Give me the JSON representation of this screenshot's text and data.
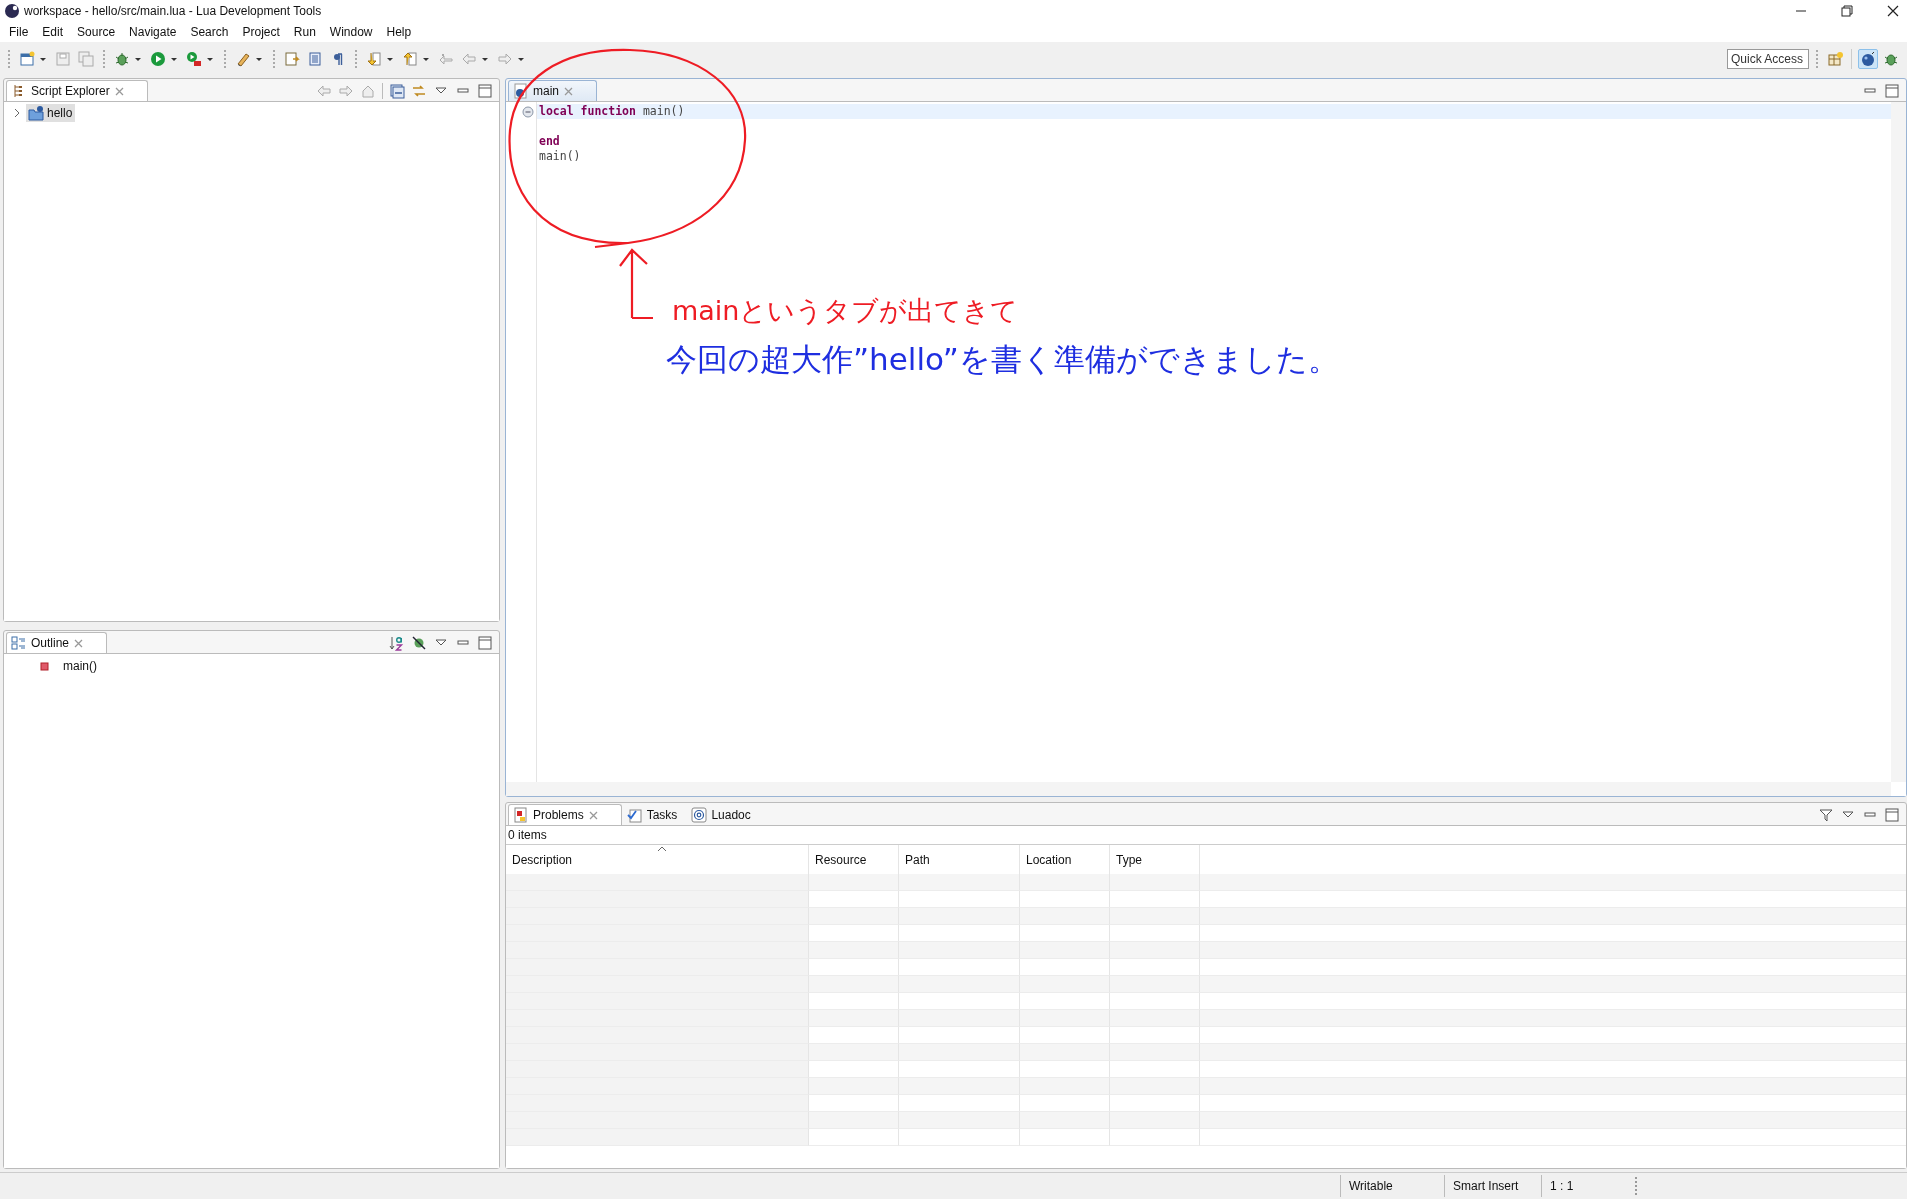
{
  "window": {
    "title": "workspace - hello/src/main.lua - Lua Development Tools"
  },
  "menu": [
    {
      "label": "File"
    },
    {
      "label": "Edit"
    },
    {
      "label": "Source"
    },
    {
      "label": "Navigate"
    },
    {
      "label": "Search"
    },
    {
      "label": "Project"
    },
    {
      "label": "Run"
    },
    {
      "label": "Window"
    },
    {
      "label": "Help"
    }
  ],
  "toolbar": {
    "quick_access": {
      "placeholder": "Quick Access"
    }
  },
  "script_explorer": {
    "tab": {
      "label": "Script Explorer",
      "selected": true
    },
    "tree": [
      {
        "label": "hello",
        "expanded": false,
        "selected": true
      }
    ]
  },
  "outline": {
    "tab": {
      "label": "Outline",
      "selected": true
    },
    "items": [
      {
        "label": "main()"
      }
    ]
  },
  "editor": {
    "tabs": [
      {
        "label": "main",
        "selected": true
      }
    ],
    "lines": [
      {
        "current": true,
        "foldable": true,
        "text": "**local** **function** main()"
      },
      {
        "current": false,
        "foldable": false
      },
      {
        "current": false,
        "foldable": false,
        "text": "**end**"
      },
      {
        "current": false,
        "foldable": false,
        "text": "main()"
      }
    ]
  },
  "problems": {
    "tabs": [
      {
        "label": "Problems",
        "selected": true,
        "closable": true
      },
      {
        "label": "Tasks",
        "selected": false,
        "closable": false
      },
      {
        "label": "Luadoc",
        "selected": false,
        "closable": false
      }
    ],
    "count": "0 items",
    "columns": [
      {
        "label": "Description",
        "sorted": true
      },
      {
        "label": "Resource",
        "sorted": false
      },
      {
        "label": "Path",
        "sorted": false
      },
      {
        "label": "Location",
        "sorted": false
      },
      {
        "label": "Type",
        "sorted": false
      }
    ]
  },
  "status_bar": [
    {
      "label": "Writable"
    },
    {
      "label": "Smart Insert"
    },
    {
      "label": "1 : 1"
    }
  ],
  "annotations": [
    {
      "kind": "note",
      "color": "#ee1c24",
      "text": "mainというタブが出てきて"
    },
    {
      "kind": "note",
      "color": "#1e2ee0",
      "text": "今回の超大作”hello”を書く準備ができました。"
    }
  ]
}
